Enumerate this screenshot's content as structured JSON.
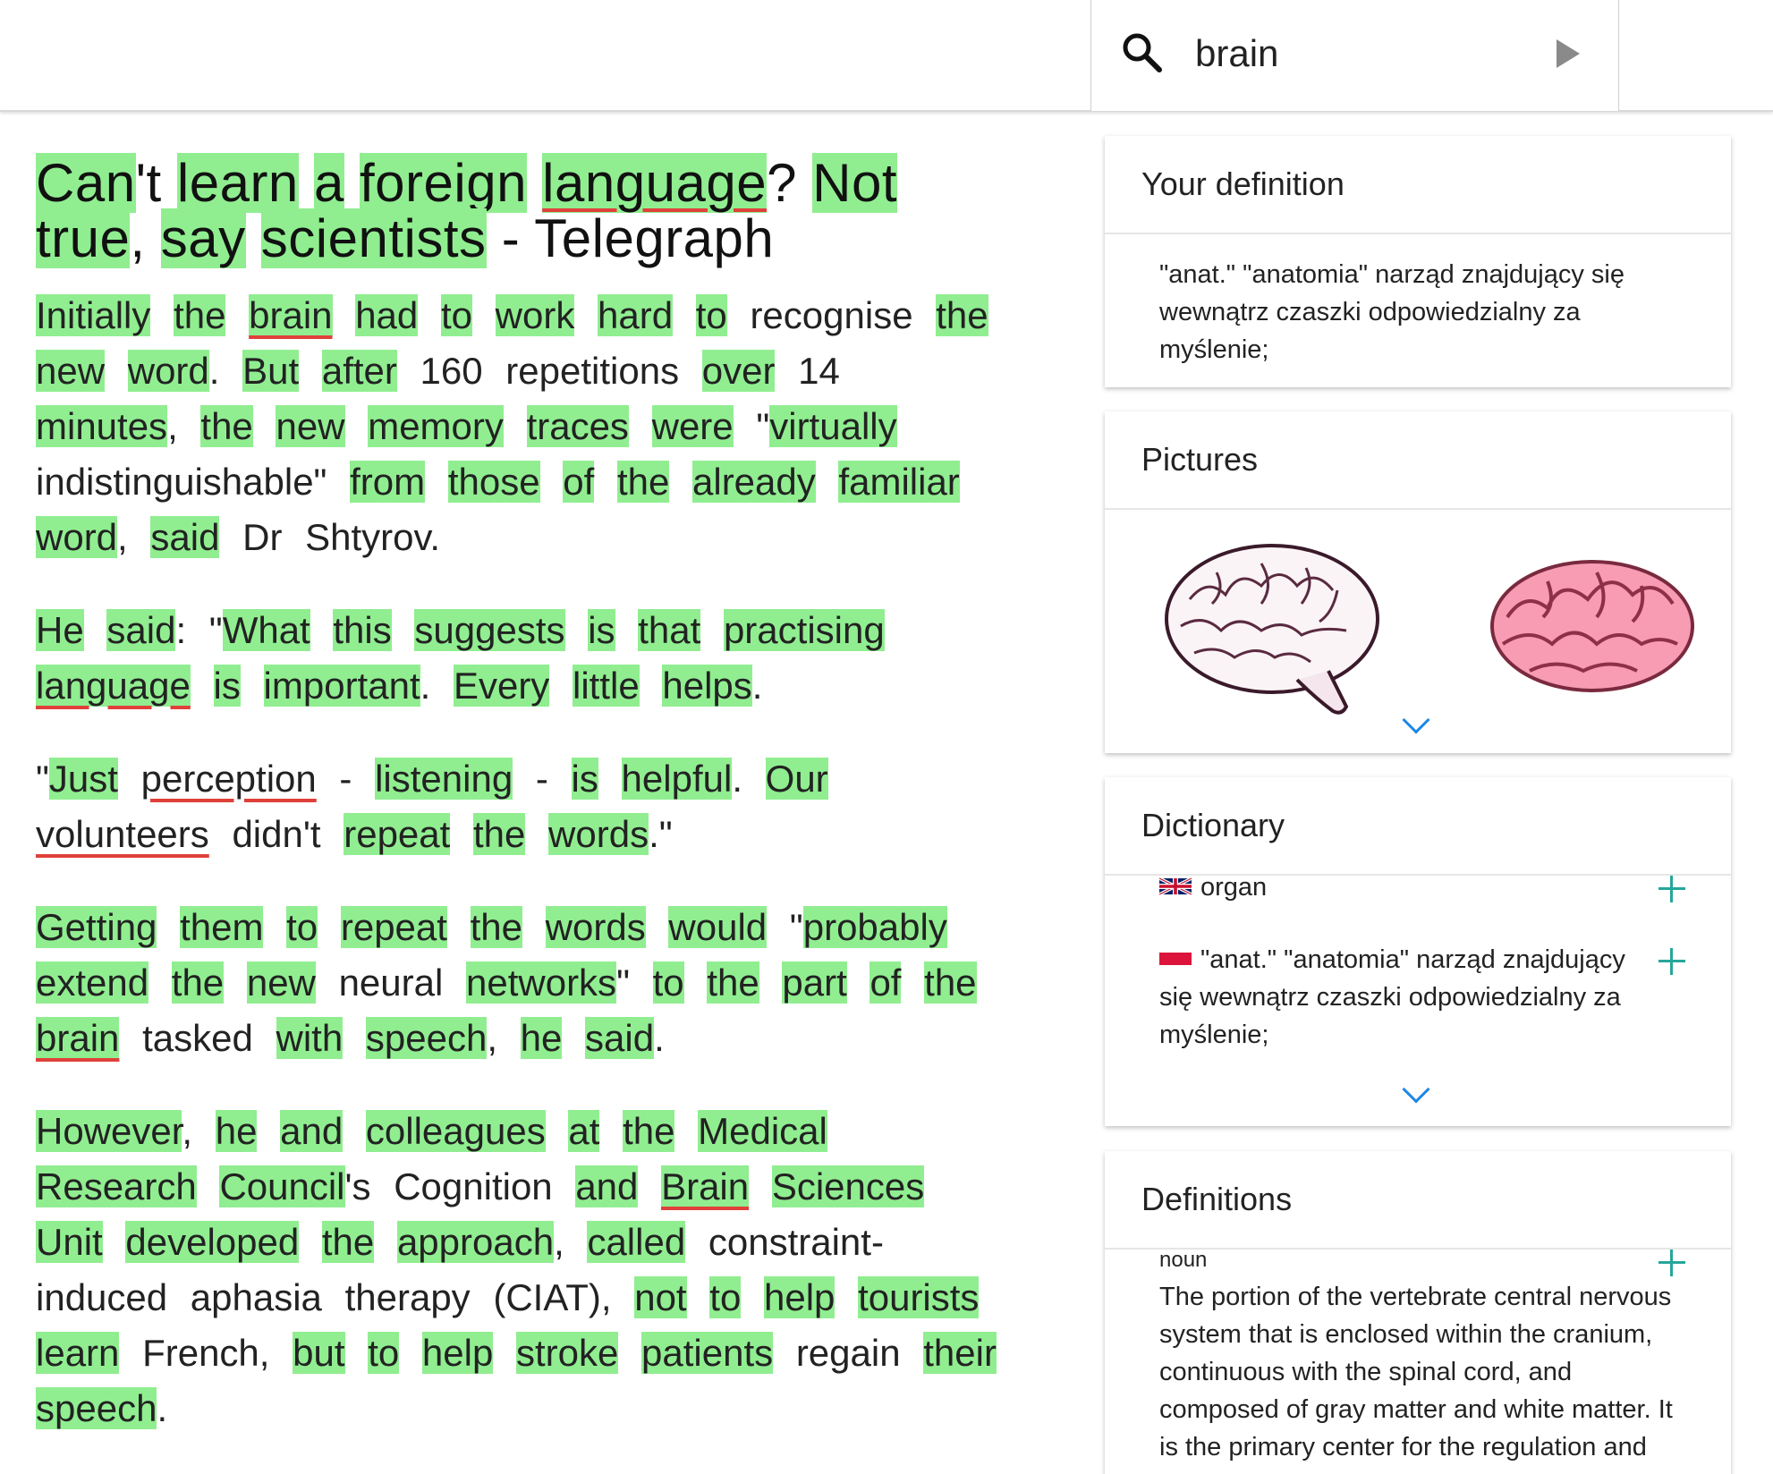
{
  "search": {
    "value": "brain"
  },
  "article": {
    "title": [
      {
        "t": "Can",
        "s": "k"
      },
      {
        "t": "'t ",
        "s": ""
      },
      {
        "t": "learn",
        "s": "k"
      },
      {
        "t": " ",
        "s": ""
      },
      {
        "t": "a",
        "s": "k"
      },
      {
        "t": " ",
        "s": ""
      },
      {
        "t": "foreign",
        "s": "k"
      },
      {
        "t": " ",
        "s": ""
      },
      {
        "t": "language",
        "s": "b"
      },
      {
        "t": "? ",
        "s": ""
      },
      {
        "t": "Not",
        "s": "k"
      },
      {
        "t": " ",
        "s": ""
      },
      {
        "t": "true",
        "s": "k"
      },
      {
        "t": ", ",
        "s": ""
      },
      {
        "t": "say",
        "s": "k"
      },
      {
        "t": " ",
        "s": ""
      },
      {
        "t": "scientists",
        "s": "k"
      },
      {
        "t": " - Telegraph",
        "s": ""
      }
    ],
    "paragraphs": [
      [
        {
          "t": "Initially",
          "s": "k"
        },
        {
          "t": " ",
          "s": ""
        },
        {
          "t": "the",
          "s": "k"
        },
        {
          "t": " ",
          "s": ""
        },
        {
          "t": "brain",
          "s": "b"
        },
        {
          "t": " ",
          "s": ""
        },
        {
          "t": "had",
          "s": "k"
        },
        {
          "t": " ",
          "s": ""
        },
        {
          "t": "to",
          "s": "k"
        },
        {
          "t": " ",
          "s": ""
        },
        {
          "t": "work",
          "s": "k"
        },
        {
          "t": " ",
          "s": ""
        },
        {
          "t": "hard",
          "s": "k"
        },
        {
          "t": " ",
          "s": ""
        },
        {
          "t": "to",
          "s": "k"
        },
        {
          "t": " recognise ",
          "s": ""
        },
        {
          "t": "the",
          "s": "k"
        },
        {
          "t": " ",
          "s": ""
        },
        {
          "t": "new",
          "s": "k"
        },
        {
          "t": " ",
          "s": ""
        },
        {
          "t": "word",
          "s": "k"
        },
        {
          "t": ". ",
          "s": ""
        },
        {
          "t": "But",
          "s": "k"
        },
        {
          "t": " ",
          "s": ""
        },
        {
          "t": "after",
          "s": "k"
        },
        {
          "t": " 160 repetitions ",
          "s": ""
        },
        {
          "t": "over",
          "s": "k"
        },
        {
          "t": " 14 ",
          "s": ""
        },
        {
          "t": "minutes",
          "s": "k"
        },
        {
          "t": ", ",
          "s": ""
        },
        {
          "t": "the",
          "s": "k"
        },
        {
          "t": " ",
          "s": ""
        },
        {
          "t": "new",
          "s": "k"
        },
        {
          "t": " ",
          "s": ""
        },
        {
          "t": "memory",
          "s": "k"
        },
        {
          "t": " ",
          "s": ""
        },
        {
          "t": "traces",
          "s": "k"
        },
        {
          "t": " ",
          "s": ""
        },
        {
          "t": "were",
          "s": "k"
        },
        {
          "t": " \"",
          "s": ""
        },
        {
          "t": "virtually",
          "s": "k"
        },
        {
          "t": " indistinguishable\" ",
          "s": ""
        },
        {
          "t": "from",
          "s": "k"
        },
        {
          "t": " ",
          "s": ""
        },
        {
          "t": "those",
          "s": "k"
        },
        {
          "t": " ",
          "s": ""
        },
        {
          "t": "of",
          "s": "k"
        },
        {
          "t": " ",
          "s": ""
        },
        {
          "t": "the",
          "s": "k"
        },
        {
          "t": " ",
          "s": ""
        },
        {
          "t": "already",
          "s": "k"
        },
        {
          "t": " ",
          "s": ""
        },
        {
          "t": "familiar",
          "s": "k"
        },
        {
          "t": " ",
          "s": ""
        },
        {
          "t": "word",
          "s": "k"
        },
        {
          "t": ", ",
          "s": ""
        },
        {
          "t": "said",
          "s": "k"
        },
        {
          "t": " Dr Shtyrov.",
          "s": ""
        }
      ],
      [
        {
          "t": "He",
          "s": "k"
        },
        {
          "t": " ",
          "s": ""
        },
        {
          "t": "said",
          "s": "k"
        },
        {
          "t": ": \"",
          "s": ""
        },
        {
          "t": "What",
          "s": "k"
        },
        {
          "t": " ",
          "s": ""
        },
        {
          "t": "this",
          "s": "k"
        },
        {
          "t": " ",
          "s": ""
        },
        {
          "t": "suggests",
          "s": "k"
        },
        {
          "t": " ",
          "s": ""
        },
        {
          "t": "is",
          "s": "k"
        },
        {
          "t": " ",
          "s": ""
        },
        {
          "t": "that",
          "s": "k"
        },
        {
          "t": " ",
          "s": ""
        },
        {
          "t": "practising",
          "s": "k"
        },
        {
          "t": " ",
          "s": ""
        },
        {
          "t": "language",
          "s": "b"
        },
        {
          "t": " ",
          "s": ""
        },
        {
          "t": "is",
          "s": "k"
        },
        {
          "t": " ",
          "s": ""
        },
        {
          "t": "important",
          "s": "k"
        },
        {
          "t": ". ",
          "s": ""
        },
        {
          "t": "Every",
          "s": "k"
        },
        {
          "t": " ",
          "s": ""
        },
        {
          "t": "little",
          "s": "k"
        },
        {
          "t": " ",
          "s": ""
        },
        {
          "t": "helps",
          "s": "k"
        },
        {
          "t": ".",
          "s": ""
        }
      ],
      [
        {
          "t": "\"",
          "s": ""
        },
        {
          "t": "Just",
          "s": "k"
        },
        {
          "t": " ",
          "s": ""
        },
        {
          "t": "perception",
          "s": "u"
        },
        {
          "t": " - ",
          "s": ""
        },
        {
          "t": "listening",
          "s": "k"
        },
        {
          "t": " - ",
          "s": ""
        },
        {
          "t": "is",
          "s": "k"
        },
        {
          "t": " ",
          "s": ""
        },
        {
          "t": "helpful",
          "s": "k"
        },
        {
          "t": ". ",
          "s": ""
        },
        {
          "t": "Our",
          "s": "k"
        },
        {
          "t": " ",
          "s": ""
        },
        {
          "t": "volunteers",
          "s": "u"
        },
        {
          "t": " didn't ",
          "s": ""
        },
        {
          "t": "repeat",
          "s": "k"
        },
        {
          "t": " ",
          "s": ""
        },
        {
          "t": "the",
          "s": "k"
        },
        {
          "t": " ",
          "s": ""
        },
        {
          "t": "words",
          "s": "k"
        },
        {
          "t": ".\"",
          "s": ""
        }
      ],
      [
        {
          "t": "Getting",
          "s": "k"
        },
        {
          "t": " ",
          "s": ""
        },
        {
          "t": "them",
          "s": "k"
        },
        {
          "t": " ",
          "s": ""
        },
        {
          "t": "to",
          "s": "k"
        },
        {
          "t": " ",
          "s": ""
        },
        {
          "t": "repeat",
          "s": "k"
        },
        {
          "t": " ",
          "s": ""
        },
        {
          "t": "the",
          "s": "k"
        },
        {
          "t": " ",
          "s": ""
        },
        {
          "t": "words",
          "s": "k"
        },
        {
          "t": " ",
          "s": ""
        },
        {
          "t": "would",
          "s": "k"
        },
        {
          "t": " \"",
          "s": ""
        },
        {
          "t": "probably",
          "s": "k"
        },
        {
          "t": " ",
          "s": ""
        },
        {
          "t": "extend",
          "s": "k"
        },
        {
          "t": " ",
          "s": ""
        },
        {
          "t": "the",
          "s": "k"
        },
        {
          "t": " ",
          "s": ""
        },
        {
          "t": "new",
          "s": "k"
        },
        {
          "t": " neural ",
          "s": ""
        },
        {
          "t": "networks",
          "s": "k"
        },
        {
          "t": "\" ",
          "s": ""
        },
        {
          "t": "to",
          "s": "k"
        },
        {
          "t": " ",
          "s": ""
        },
        {
          "t": "the",
          "s": "k"
        },
        {
          "t": " ",
          "s": ""
        },
        {
          "t": "part",
          "s": "k"
        },
        {
          "t": " ",
          "s": ""
        },
        {
          "t": "of",
          "s": "k"
        },
        {
          "t": " ",
          "s": ""
        },
        {
          "t": "the",
          "s": "k"
        },
        {
          "t": " ",
          "s": ""
        },
        {
          "t": "brain",
          "s": "b"
        },
        {
          "t": " tasked ",
          "s": ""
        },
        {
          "t": "with",
          "s": "k"
        },
        {
          "t": " ",
          "s": ""
        },
        {
          "t": "speech",
          "s": "k"
        },
        {
          "t": ", ",
          "s": ""
        },
        {
          "t": "he",
          "s": "k"
        },
        {
          "t": " ",
          "s": ""
        },
        {
          "t": "said",
          "s": "k"
        },
        {
          "t": ".",
          "s": ""
        }
      ],
      [
        {
          "t": "However",
          "s": "k"
        },
        {
          "t": ", ",
          "s": ""
        },
        {
          "t": "he",
          "s": "k"
        },
        {
          "t": " ",
          "s": ""
        },
        {
          "t": "and",
          "s": "k"
        },
        {
          "t": " ",
          "s": ""
        },
        {
          "t": "colleagues",
          "s": "k"
        },
        {
          "t": " ",
          "s": ""
        },
        {
          "t": "at",
          "s": "k"
        },
        {
          "t": " ",
          "s": ""
        },
        {
          "t": "the",
          "s": "k"
        },
        {
          "t": " ",
          "s": ""
        },
        {
          "t": "Medical",
          "s": "k"
        },
        {
          "t": " ",
          "s": ""
        },
        {
          "t": "Research",
          "s": "k"
        },
        {
          "t": " ",
          "s": ""
        },
        {
          "t": "Council",
          "s": "k"
        },
        {
          "t": "'s Cognition ",
          "s": ""
        },
        {
          "t": "and",
          "s": "k"
        },
        {
          "t": " ",
          "s": ""
        },
        {
          "t": "Brain",
          "s": "b"
        },
        {
          "t": " ",
          "s": ""
        },
        {
          "t": "Sciences",
          "s": "k"
        },
        {
          "t": " ",
          "s": ""
        },
        {
          "t": "Unit",
          "s": "k"
        },
        {
          "t": " ",
          "s": ""
        },
        {
          "t": "developed",
          "s": "k"
        },
        {
          "t": " ",
          "s": ""
        },
        {
          "t": "the",
          "s": "k"
        },
        {
          "t": " ",
          "s": ""
        },
        {
          "t": "approach",
          "s": "k"
        },
        {
          "t": ", ",
          "s": ""
        },
        {
          "t": "called",
          "s": "k"
        },
        {
          "t": " constraint-induced aphasia therapy (CIAT), ",
          "s": ""
        },
        {
          "t": "not",
          "s": "k"
        },
        {
          "t": " ",
          "s": ""
        },
        {
          "t": "to",
          "s": "k"
        },
        {
          "t": " ",
          "s": ""
        },
        {
          "t": "help",
          "s": "k"
        },
        {
          "t": " ",
          "s": ""
        },
        {
          "t": "tourists",
          "s": "k"
        },
        {
          "t": " ",
          "s": ""
        },
        {
          "t": "learn",
          "s": "k"
        },
        {
          "t": " French, ",
          "s": ""
        },
        {
          "t": "but",
          "s": "k"
        },
        {
          "t": " ",
          "s": ""
        },
        {
          "t": "to",
          "s": "k"
        },
        {
          "t": " ",
          "s": ""
        },
        {
          "t": "help",
          "s": "k"
        },
        {
          "t": " ",
          "s": ""
        },
        {
          "t": "stroke",
          "s": "k"
        },
        {
          "t": " ",
          "s": ""
        },
        {
          "t": "patients",
          "s": "k"
        },
        {
          "t": " ",
          "s": ""
        },
        {
          "t": "regain ",
          "s": ""
        },
        {
          "t": "their",
          "s": "k"
        },
        {
          "t": " ",
          "s": ""
        },
        {
          "t": "speech",
          "s": "k"
        },
        {
          "t": ".",
          "s": ""
        }
      ]
    ]
  },
  "your_definition": {
    "title": "Your definition",
    "text": "\"anat.\" \"anatomia\" narząd znajdujący się wewnątrz czaszki odpowiedzialny za myślenie;"
  },
  "pictures": {
    "title": "Pictures"
  },
  "dictionary": {
    "title": "Dictionary",
    "entries": [
      {
        "flag": "uk",
        "text": "organ"
      },
      {
        "flag": "pl",
        "text": "\"anat.\" \"anatomia\" narząd znajdujący się wewnątrz czaszki odpowiedzialny za myślenie;"
      }
    ]
  },
  "definitions": {
    "title": "Definitions",
    "pos": "noun",
    "text": "The portion of the vertebrate central nervous system that is enclosed within the cranium, continuous with the spinal cord, and composed of gray matter and white matter. It is the primary center for the regulation and"
  },
  "colors": {
    "known_highlight": "#90ee90",
    "unknown_underline": "#e0403a",
    "accent_plus": "#26a69a",
    "chevron": "#1e88e5"
  }
}
